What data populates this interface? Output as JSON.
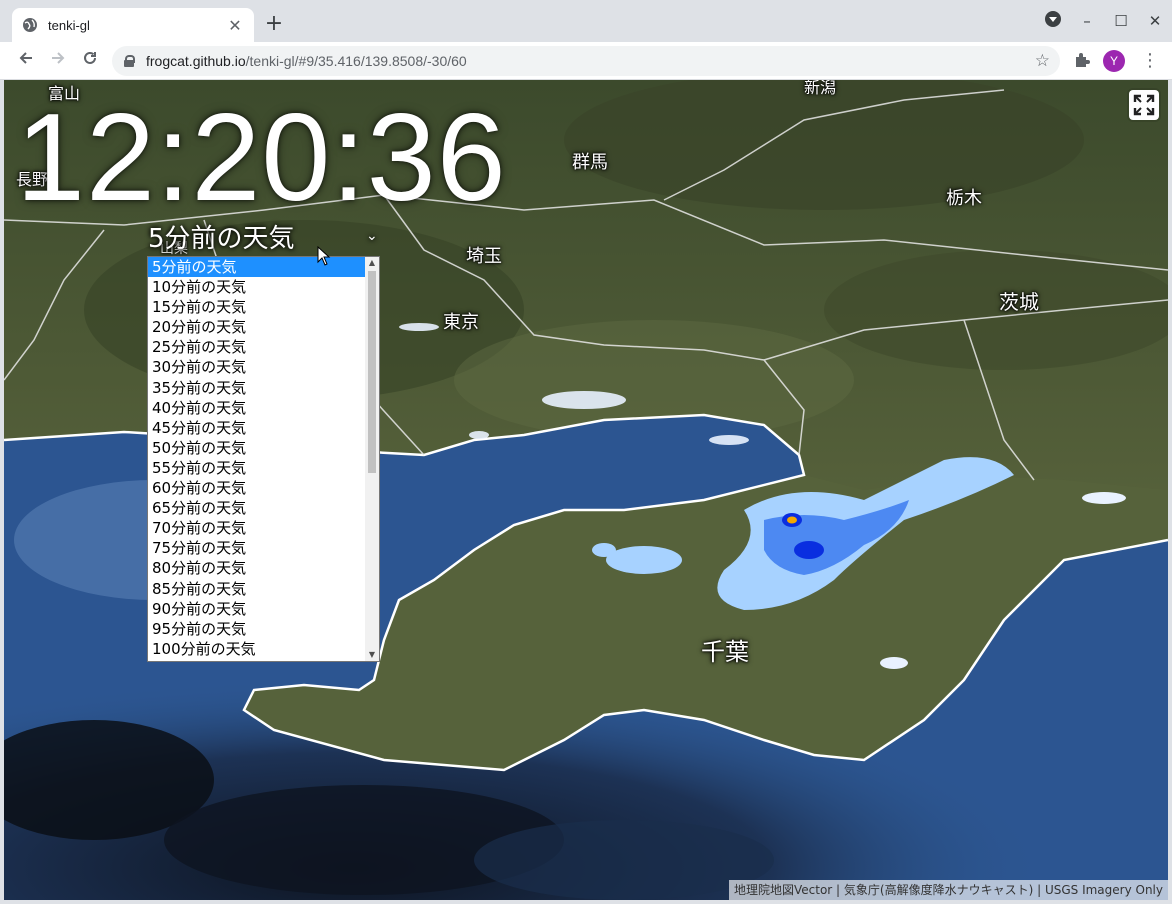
{
  "browser": {
    "tab_title": "tenki-gl",
    "url_host": "frogcat.github.io",
    "url_path": "/tenki-gl/#9/35.416/139.8508/-30/60",
    "avatar_letter": "Y",
    "icons": {
      "tab": "globe-icon",
      "close": "close-icon",
      "new_tab": "plus-icon",
      "back": "arrow-left-icon",
      "forward": "arrow-right-icon",
      "reload": "reload-icon",
      "secure": "lock-icon",
      "bookmark": "star-icon",
      "extensions": "puzzle-icon",
      "menu": "kebab-menu-icon",
      "minimize": "minimize-icon",
      "maximize": "maximize-icon",
      "window_close": "close-icon"
    }
  },
  "map": {
    "clock": "12:20:36",
    "selected": "5分前の天気",
    "options": [
      "5分前の天気",
      "10分前の天気",
      "15分前の天気",
      "20分前の天気",
      "25分前の天気",
      "30分前の天気",
      "35分前の天気",
      "40分前の天気",
      "45分前の天気",
      "50分前の天気",
      "55分前の天気",
      "60分前の天気",
      "65分前の天気",
      "70分前の天気",
      "75分前の天気",
      "80分前の天気",
      "85分前の天気",
      "90分前の天気",
      "95分前の天気",
      "100分前の天気"
    ],
    "labels": {
      "toyama": "富山",
      "nagano": "長野",
      "niigata": "新潟",
      "gunma": "群馬",
      "tochigi": "栃木",
      "saitama": "埼玉",
      "ibaraki": "茨城",
      "tokyo": "東京",
      "chiba": "千葉",
      "yamanashi": "山梨"
    },
    "attribution": "地理院地図Vector | 気象庁(高解像度降水ナウキャスト) | USGS Imagery Only",
    "colors": {
      "land": "#4d5a35",
      "sea": "#2f5a96",
      "rain_light": "#a7d2ff",
      "rain_mid": "#3d7cf0",
      "rain_heavy": "#0a2ee0",
      "rain_peak": "#f5a800",
      "selection": "#1e90ff"
    }
  }
}
